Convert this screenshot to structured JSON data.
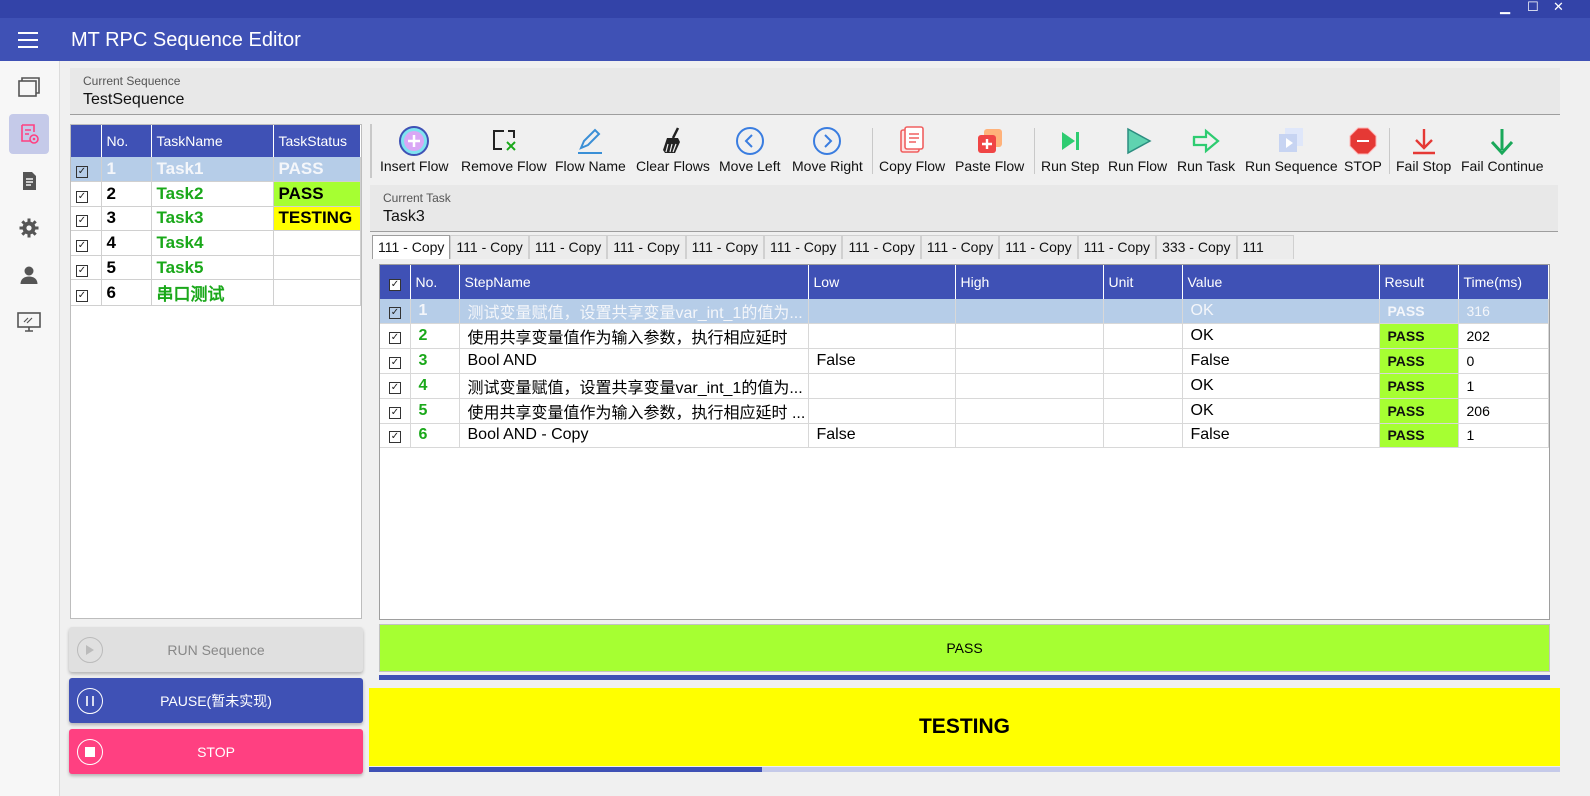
{
  "window": {
    "minimize": "▁",
    "maximize": "☐",
    "close": "✕"
  },
  "app": {
    "title": "MT RPC Sequence Editor"
  },
  "nav": [
    "layers-icon",
    "sequence-icon",
    "document-icon",
    "settings-icon",
    "user-icon",
    "monitor-icon"
  ],
  "sequence": {
    "label": "Current Sequence",
    "value": "TestSequence"
  },
  "task_table": {
    "headers": [
      "No.",
      "TaskName",
      "TaskStatus"
    ],
    "rows": [
      {
        "no": "1",
        "name": "Task1",
        "status": "PASS"
      },
      {
        "no": "2",
        "name": "Task2",
        "status": "PASS"
      },
      {
        "no": "3",
        "name": "Task3",
        "status": "TESTING"
      },
      {
        "no": "4",
        "name": "Task4",
        "status": ""
      },
      {
        "no": "5",
        "name": "Task5",
        "status": ""
      },
      {
        "no": "6",
        "name": "串口测试",
        "status": ""
      }
    ]
  },
  "buttons": {
    "run": "RUN Sequence",
    "pause": "PAUSE(暂未实现)",
    "stop": "STOP"
  },
  "toolbar": {
    "insert_flow": "Insert Flow",
    "remove_flow": "Remove Flow",
    "flow_name": "Flow Name",
    "clear_flows": "Clear Flows",
    "move_left": "Move Left",
    "move_right": "Move Right",
    "copy_flow": "Copy Flow",
    "paste_flow": "Paste Flow",
    "run_step": "Run Step",
    "run_flow": "Run Flow",
    "run_task": "Run Task",
    "run_sequence": "Run Sequence",
    "stop": "STOP",
    "fail_stop": "Fail Stop",
    "fail_continue": "Fail Continue"
  },
  "task": {
    "label": "Current Task",
    "value": "Task3"
  },
  "tabs": [
    "111 - Copy",
    "111 - Copy",
    "111 - Copy",
    "111 - Copy",
    "111 - Copy",
    "111 - Copy",
    "111 - Copy",
    "111 - Copy",
    "111 - Copy",
    "111 - Copy",
    "333 - Copy",
    "111"
  ],
  "step_table": {
    "headers": [
      "No.",
      "StepName",
      "Low",
      "High",
      "Unit",
      "Value",
      "Result",
      "Time(ms)"
    ],
    "rows": [
      {
        "no": "1",
        "name": "测试变量赋值，设置共享变量var_int_1的值为...",
        "low": "",
        "high": "",
        "unit": "",
        "value": "OK",
        "result": "PASS",
        "time": "316"
      },
      {
        "no": "2",
        "name": "使用共享变量值作为输入参数，执行相应延时",
        "low": "",
        "high": "",
        "unit": "",
        "value": "OK",
        "result": "PASS",
        "time": "202"
      },
      {
        "no": "3",
        "name": "Bool AND",
        "low": "False",
        "high": "",
        "unit": "",
        "value": "False",
        "result": "PASS",
        "time": "0"
      },
      {
        "no": "4",
        "name": "测试变量赋值，设置共享变量var_int_1的值为...",
        "low": "",
        "high": "",
        "unit": "",
        "value": "OK",
        "result": "PASS",
        "time": "1"
      },
      {
        "no": "5",
        "name": "使用共享变量值作为输入参数，执行相应延时 ...",
        "low": "",
        "high": "",
        "unit": "",
        "value": "OK",
        "result": "PASS",
        "time": "206"
      },
      {
        "no": "6",
        "name": "Bool AND - Copy",
        "low": "False",
        "high": "",
        "unit": "",
        "value": "False",
        "result": "PASS",
        "time": "1"
      }
    ]
  },
  "flow_result": "PASS",
  "sequence_status": "TESTING",
  "progress": 0.33,
  "colors": {
    "primary": "#3f51b5",
    "pass": "#a6ff32",
    "testing": "#ffff00",
    "stop": "#ff4081",
    "task_name": "#1aa81a"
  }
}
